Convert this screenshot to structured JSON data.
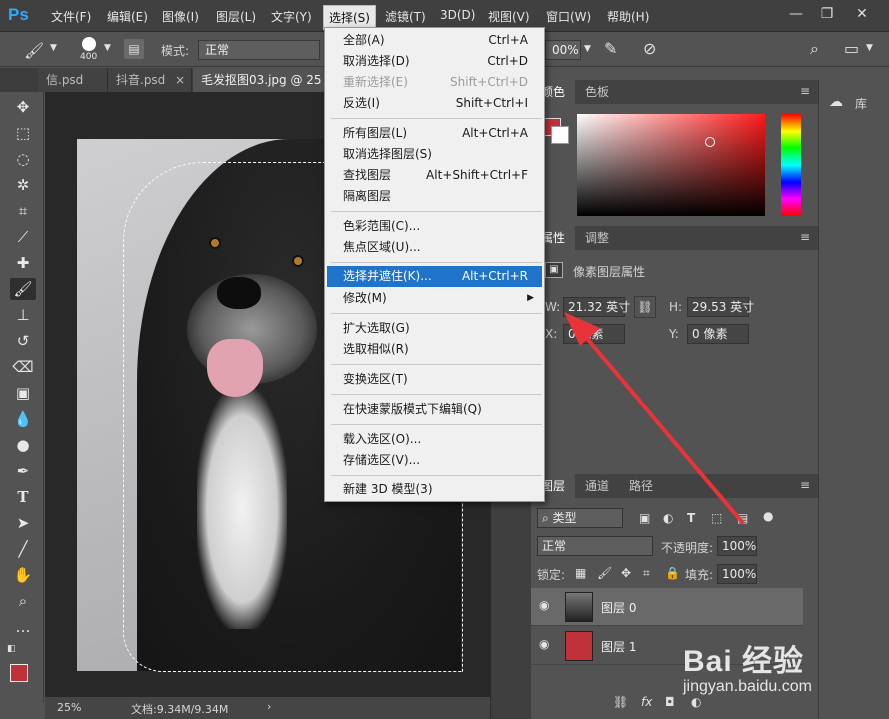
{
  "app": {
    "logo": "Ps"
  },
  "menubar": {
    "items": [
      "文件(F)",
      "编辑(E)",
      "图像(I)",
      "图层(L)",
      "文字(Y)",
      "选择(S)",
      "滤镜(T)",
      "3D(D)",
      "视图(V)",
      "窗口(W)",
      "帮助(H)"
    ],
    "active_index": 5
  },
  "options": {
    "brush_size": "400",
    "mode_label": "模式:",
    "mode_value": "正常",
    "zoom_value": "00%"
  },
  "tabs": [
    {
      "label": "信.psd",
      "close": "×"
    },
    {
      "label": "抖音.psd",
      "close": "×"
    },
    {
      "label": "毛发抠图03.jpg @ 25",
      "close": ""
    }
  ],
  "select_menu": {
    "items": [
      {
        "label": "全部(A)",
        "shortcut": "Ctrl+A",
        "disabled": false
      },
      {
        "label": "取消选择(D)",
        "shortcut": "Ctrl+D",
        "disabled": false
      },
      {
        "label": "重新选择(E)",
        "shortcut": "Shift+Ctrl+D",
        "disabled": true
      },
      {
        "label": "反选(I)",
        "shortcut": "Shift+Ctrl+I",
        "disabled": false
      },
      {
        "label": "所有图层(L)",
        "shortcut": "Alt+Ctrl+A",
        "disabled": false
      },
      {
        "label": "取消选择图层(S)",
        "shortcut": "",
        "disabled": false
      },
      {
        "label": "查找图层",
        "shortcut": "Alt+Shift+Ctrl+F",
        "disabled": false
      },
      {
        "label": "隔离图层",
        "shortcut": "",
        "disabled": false
      },
      {
        "label": "色彩范围(C)...",
        "shortcut": "",
        "disabled": false
      },
      {
        "label": "焦点区域(U)...",
        "shortcut": "",
        "disabled": false
      },
      {
        "label": "选择并遮住(K)...",
        "shortcut": "Alt+Ctrl+R",
        "disabled": false,
        "highlighted": true
      },
      {
        "label": "修改(M)",
        "shortcut": "",
        "disabled": false,
        "submenu": true
      },
      {
        "label": "扩大选取(G)",
        "shortcut": "",
        "disabled": false
      },
      {
        "label": "选取相似(R)",
        "shortcut": "",
        "disabled": false
      },
      {
        "label": "变换选区(T)",
        "shortcut": "",
        "disabled": false
      },
      {
        "label": "在快速蒙版模式下编辑(Q)",
        "shortcut": "",
        "disabled": false
      },
      {
        "label": "载入选区(O)...",
        "shortcut": "",
        "disabled": false
      },
      {
        "label": "存储选区(V)...",
        "shortcut": "",
        "disabled": false
      },
      {
        "label": "新建 3D 模型(3)",
        "shortcut": "",
        "disabled": false
      }
    ]
  },
  "color_panel": {
    "tabs": [
      "颜色",
      "色板"
    ],
    "foreground_color": "#c1313a",
    "background_color": "#ffffff"
  },
  "properties_panel": {
    "tabs": [
      "属性",
      "调整"
    ],
    "title": "像素图层属性",
    "w_label": "W:",
    "w_value": "21.32 英寸",
    "h_label": "H:",
    "h_value": "29.53 英寸",
    "x_label": "X:",
    "x_value": "0 像素",
    "y_label": "Y:",
    "y_value": "0 像素"
  },
  "layers_panel": {
    "tabs": [
      "图层",
      "通道",
      "路径"
    ],
    "filter_kind": "类型",
    "blend_mode": "正常",
    "opacity_label": "不透明度:",
    "opacity_value": "100%",
    "lock_label": "锁定:",
    "fill_label": "填充:",
    "fill_value": "100%",
    "layers": [
      {
        "name": "图层 0",
        "selected": true
      },
      {
        "name": "图层 1",
        "selected": false,
        "color": "#c1313a"
      }
    ]
  },
  "library": {
    "label": "库"
  },
  "status": {
    "zoom": "25%",
    "doc": "文档:9.34M/9.34M"
  },
  "watermark": {
    "main": "Bai 经验",
    "sub": "jingyan.baidu.com"
  }
}
